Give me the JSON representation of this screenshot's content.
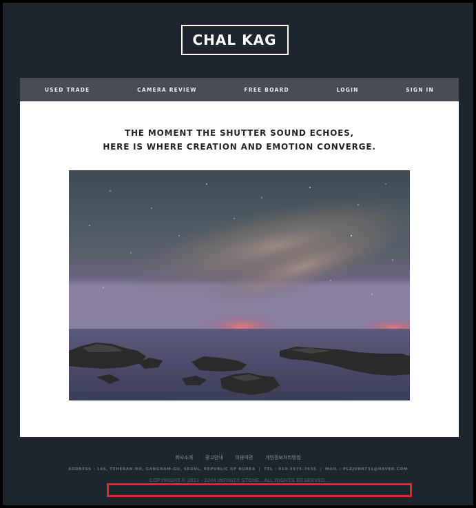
{
  "header": {
    "logo_text": "CHAL KAG"
  },
  "nav": {
    "items": [
      {
        "label": "USED TRADE"
      },
      {
        "label": "CAMERA REVIEW"
      },
      {
        "label": "FREE BOARD"
      },
      {
        "label": "LOGIN"
      },
      {
        "label": "SIGN IN"
      }
    ]
  },
  "main": {
    "tagline_line1": "THE MOMENT THE SHUTTER SOUND ECHOES,",
    "tagline_line2": "HERE IS WHERE CREATION AND EMOTION CONVERGE."
  },
  "footer": {
    "links": [
      "회사소개",
      "광고안내",
      "이용약관",
      "개인정보처리방침"
    ],
    "separator": ":",
    "address": "ADDRESS : 146, TEHERAN-RO, GANGNAM-GU, SEOUL, REPUBLIC OF KOREA",
    "tel": "TEL : 010-3975-7635",
    "mail": "MAIL : PLZJUN0731@NAVER.COM",
    "copyright": "COPYRIGHT © 2023 - 2024 INFINITY STONE . ALL RIGHTS RESERVED."
  },
  "colors": {
    "page_background": "#1f252c",
    "nav_background": "#474c55",
    "content_background": "#ffffff",
    "highlight": "#e5262b"
  }
}
